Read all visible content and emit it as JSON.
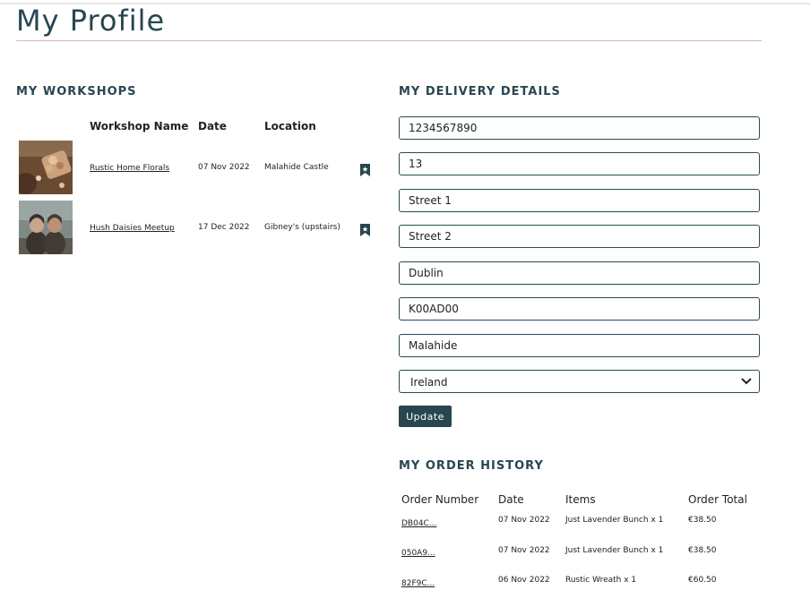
{
  "page": {
    "title": "My Profile"
  },
  "workshops": {
    "heading": "MY WORKSHOPS",
    "columns": {
      "name": "Workshop Name",
      "date": "Date",
      "location": "Location"
    },
    "rows": [
      {
        "name": "Rustic Home Florals",
        "date": "07 Nov 2022",
        "location": "Malahide Castle",
        "icon": "bookmark-icon"
      },
      {
        "name": "Hush Daisies Meetup",
        "date": "17 Dec 2022",
        "location": "Gibney's (upstairs)",
        "icon": "bookmark-icon"
      }
    ]
  },
  "delivery": {
    "heading": "MY DELIVERY DETAILS",
    "fields": [
      {
        "name": "phone-number",
        "value": "1234567890"
      },
      {
        "name": "house-number",
        "value": "13"
      },
      {
        "name": "street-address-1",
        "value": "Street 1"
      },
      {
        "name": "street-address-2",
        "value": "Street 2"
      },
      {
        "name": "town-or-city",
        "value": "Dublin"
      },
      {
        "name": "postcode",
        "value": "K00AD00"
      },
      {
        "name": "county",
        "value": "Malahide"
      }
    ],
    "country": {
      "selected": "Ireland",
      "icon": "chevron-down-icon"
    },
    "update_label": "Update"
  },
  "orders": {
    "heading": "MY ORDER HISTORY",
    "columns": {
      "number": "Order Number",
      "date": "Date",
      "items": "Items",
      "total": "Order Total"
    },
    "rows": [
      {
        "number": "DB04C...",
        "date": "07 Nov 2022",
        "items": "Just Lavender Bunch x 1",
        "total": "€38.50"
      },
      {
        "number": "050A9...",
        "date": "07 Nov 2022",
        "items": "Just Lavender Bunch x 1",
        "total": "€38.50"
      },
      {
        "number": "82F9C...",
        "date": "06 Nov 2022",
        "items": "Rustic Wreath x 1",
        "total": "€60.50"
      }
    ]
  },
  "colors": {
    "brand": "#284650",
    "accent_rule": "#d8b5b9",
    "field_border": "#2a4a55"
  }
}
